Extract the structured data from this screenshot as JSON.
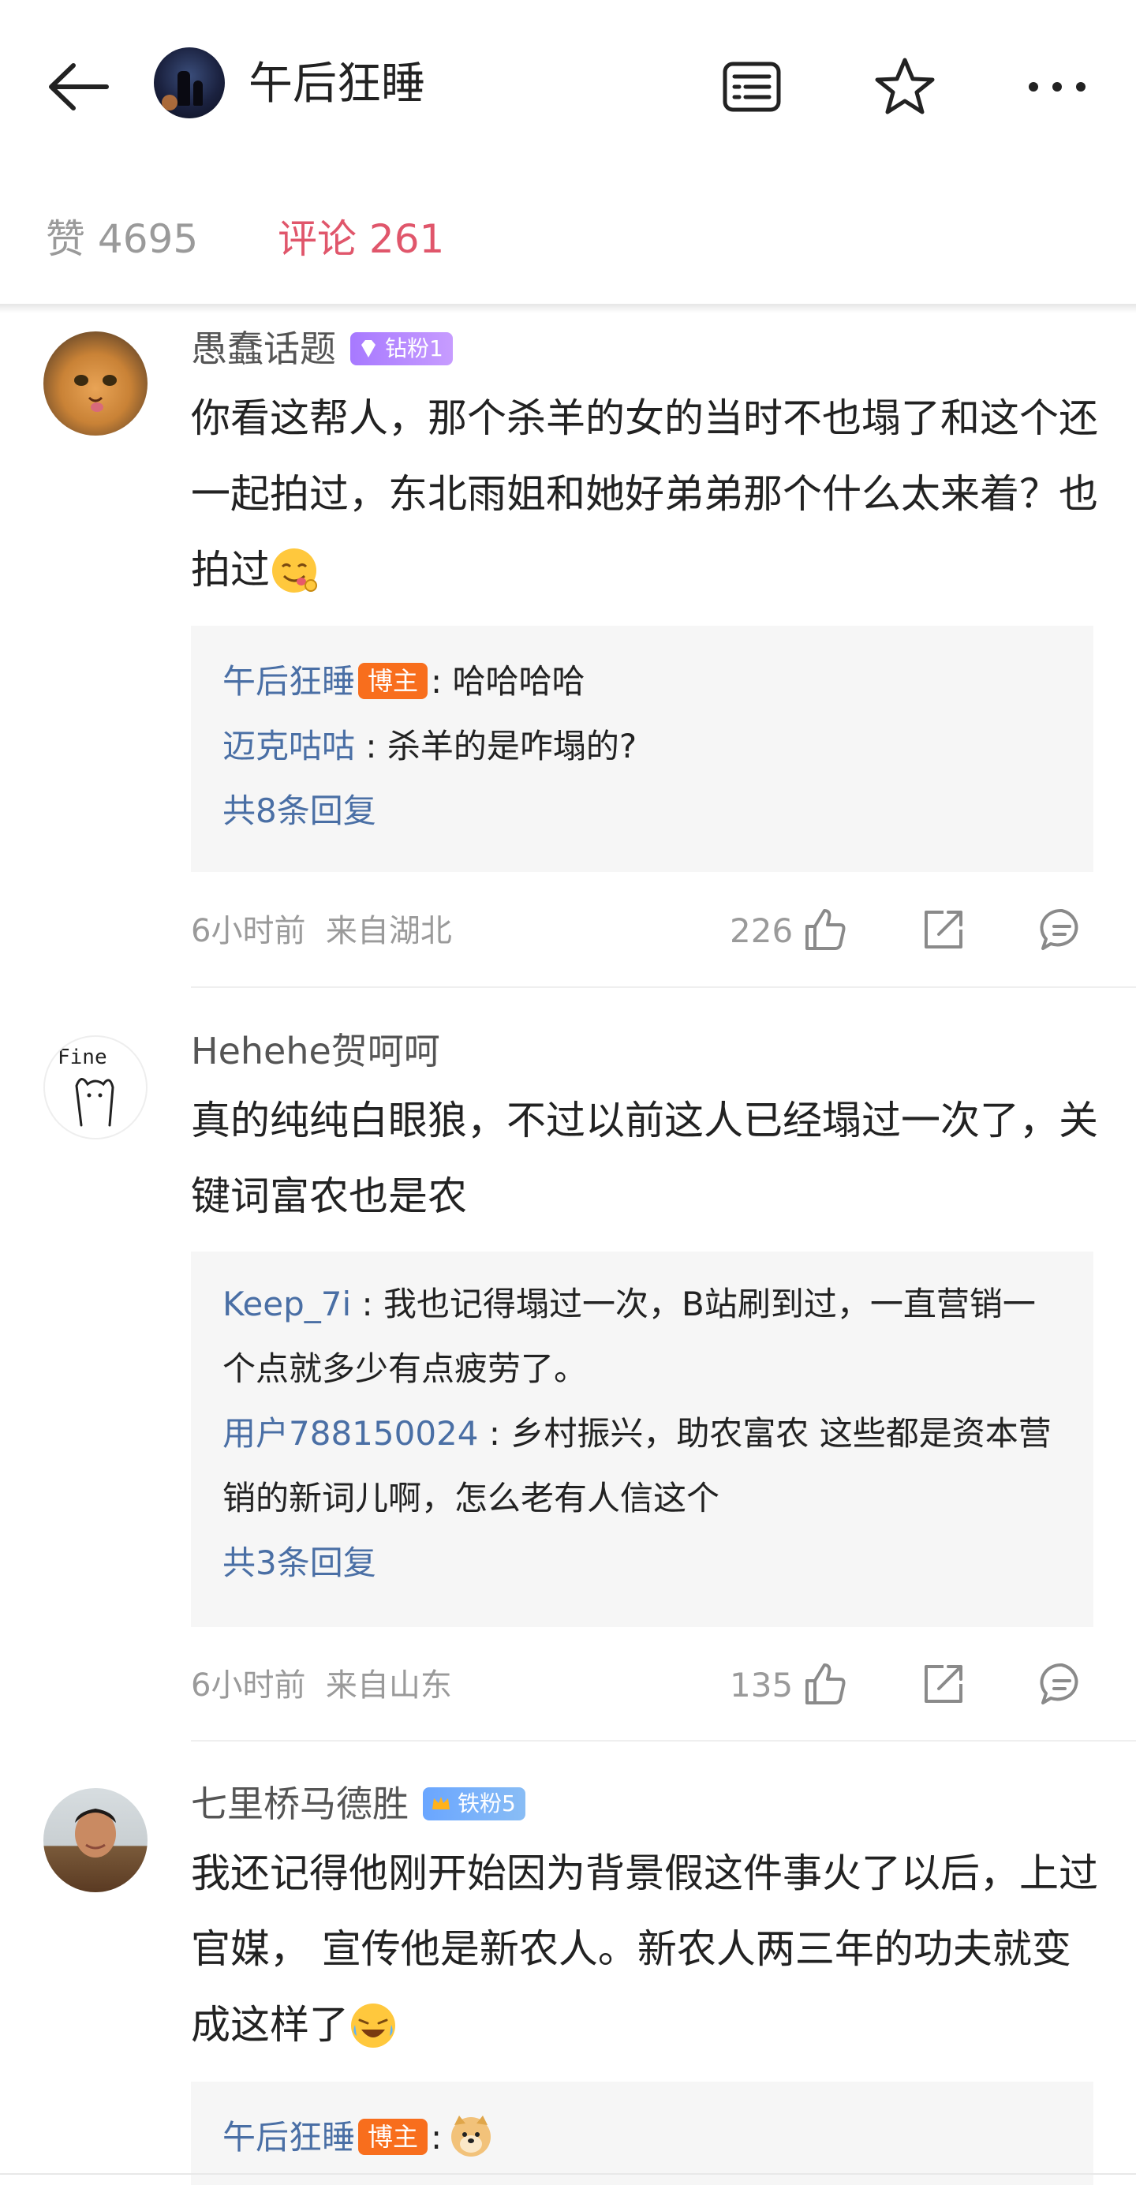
{
  "header": {
    "title": "午后狂睡",
    "back_icon": "back-arrow-icon",
    "actions": [
      "list-icon",
      "star-icon",
      "more-icon"
    ]
  },
  "tabs": {
    "likes_label": "赞 4695",
    "comments_label": "评论 261"
  },
  "colors": {
    "accent": "#e0566b",
    "link": "#4a6fa5",
    "host_badge": "#f86e1d"
  },
  "comments": [
    {
      "username": "愚蠢话题",
      "badge": "钻粉1",
      "text": "你看这帮人，那个杀羊的女的当时不也塌了和这个还一起拍过，东北雨姐和她好弟弟那个什么太来着？也拍过",
      "replies": [
        {
          "name": "午后狂睡",
          "badge": "博主",
          "text": ": 哈哈哈哈"
        },
        {
          "name": "迈克咕咕",
          "text": " : 杀羊的是咋塌的?"
        }
      ],
      "more_replies": "共8条回复",
      "time": "6小时前",
      "location": "来自湖北",
      "likes": "226"
    },
    {
      "username": "Hehehe贺呵呵",
      "text": "真的纯纯白眼狼，不过以前这人已经塌过一次了，关键词富农也是农",
      "replies": [
        {
          "name": "Keep_7i",
          "text": " : 我也记得塌过一次，B站刷到过，一直营销一个点就多少有点疲劳了。"
        },
        {
          "name": "用户788150024",
          "text": " : 乡村振兴，助农富农 这些都是资本营销的新词儿啊，怎么老有人信这个"
        }
      ],
      "more_replies": "共3条回复",
      "time": "6小时前",
      "location": "来自山东",
      "likes": "135"
    },
    {
      "username": "七里桥马德胜",
      "badge": "铁粉5",
      "text": "我还记得他刚开始因为背景假这件事火了以后，上过官媒， 宣传他是新农人。新农人两三年的功夫就变成这样了",
      "replies": [
        {
          "name": "午后狂睡",
          "badge": "博主",
          "text": ":"
        }
      ]
    }
  ]
}
